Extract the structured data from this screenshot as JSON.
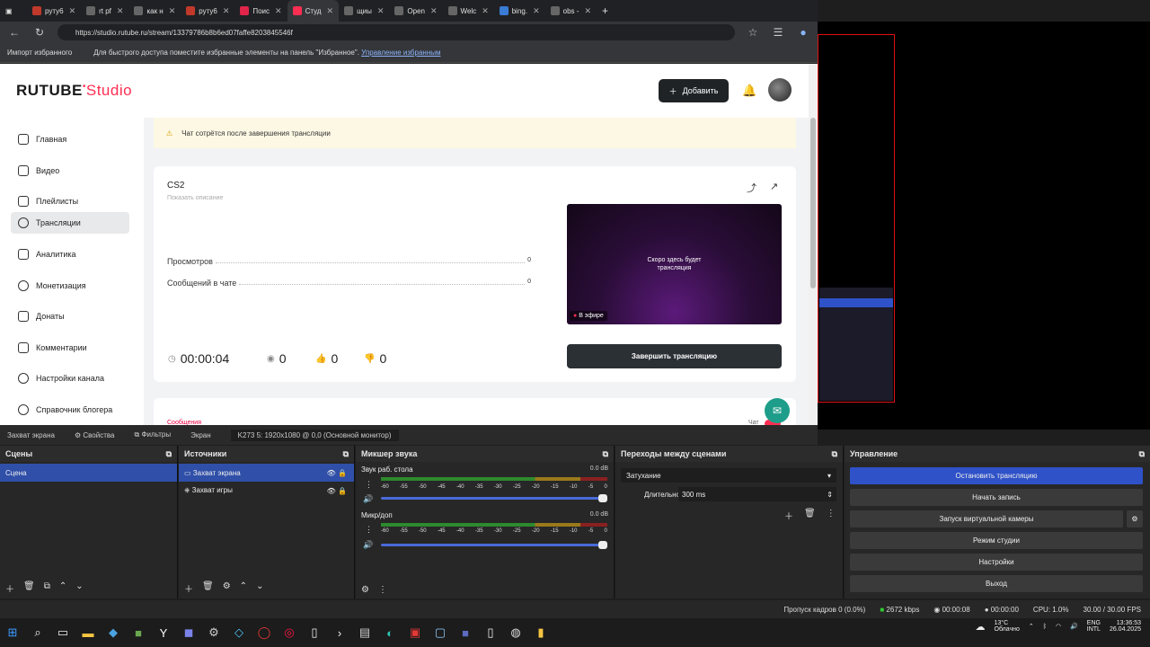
{
  "browser": {
    "tabs": [
      "руту6",
      "rt pf",
      "как н",
      "руту6",
      "Поис",
      "Студ",
      "щиы",
      "Open",
      "Welc",
      "bing.",
      "obs -"
    ],
    "url": "https://studio.rutube.ru/stream/13379786b8b6ed07faffe8203845546f",
    "favbar": {
      "import": "Импорт избранного",
      "hint": "Для быстрого доступа поместите избранные элементы на панель \"Избранное\".",
      "manage": "Управление избранным"
    }
  },
  "studio": {
    "logo_main": "RUTUBE",
    "logo_sub": "Studio",
    "add_button": "Добавить",
    "sidebar": [
      "Главная",
      "Видео",
      "Плейлисты",
      "Трансляции",
      "Аналитика",
      "Монетизация",
      "Донаты",
      "Комментарии",
      "Настройки канала",
      "Справочник блогера"
    ],
    "notice": "Чат сотрётся после завершения трансляции",
    "stream": {
      "title": "CS2",
      "show_description": "Показать описание",
      "views_label": "Просмотров",
      "views_value": "0",
      "chat_label": "Сообщений в чате",
      "chat_value": "0",
      "timer": "00:00:04",
      "viewers": "0",
      "likes": "0",
      "dislikes": "0",
      "preview_text_line1": "Скоро здесь будет",
      "preview_text_line2": "трансляция",
      "live_badge": "В эфире",
      "end_button": "Завершить трансляцию"
    },
    "messages_label": "Сообщения",
    "chat_label": "Чат"
  },
  "obs": {
    "source_bar": [
      "Захват экрана",
      "Свойства",
      "Фильтры",
      "Экран",
      "K273 5: 1920x1080 @ 0,0 (Основной монитор)"
    ],
    "scenes_title": "Сцены",
    "scenes": [
      "Сцена"
    ],
    "sources_title": "Источники",
    "sources": [
      "Захват экрана",
      "Захват игры"
    ],
    "mixer_title": "Микшер звука",
    "mixer": [
      {
        "name": "Звук раб. стола",
        "db": "0.0 dB"
      },
      {
        "name": "Микр/доп",
        "db": "0.0 dB"
      }
    ],
    "meter_ticks": [
      "-60",
      "-55",
      "-50",
      "-45",
      "-40",
      "-35",
      "-30",
      "-25",
      "-20",
      "-15",
      "-10",
      "-5",
      "0"
    ],
    "transitions_title": "Переходы между сценами",
    "transition_value": "Затухание",
    "duration_label": "Длительность",
    "duration_value": "300 ms",
    "controls_title": "Управление",
    "controls": [
      "Остановить трансляцию",
      "Начать запись",
      "Запуск виртуальной камеры",
      "Режим студии",
      "Настройки",
      "Выход"
    ],
    "status": {
      "dropped": "Пропуск кадров 0 (0.0%)",
      "bitrate": "2672 kbps",
      "stream_time": "00:00:08",
      "rec_time": "00:00:00",
      "cpu": "CPU: 1.0%",
      "fps": "30.00 / 30.00 FPS"
    }
  },
  "taskbar": {
    "weather_temp": "13°C",
    "weather_text": "Облачно",
    "lang1": "ENG",
    "lang2": "INTL",
    "time": "13:36:53",
    "date": "26.04.2025"
  },
  "colors": {
    "accent": "#ff2e52",
    "obs_blue": "#2f52c8",
    "teal": "#1e9e8a"
  }
}
